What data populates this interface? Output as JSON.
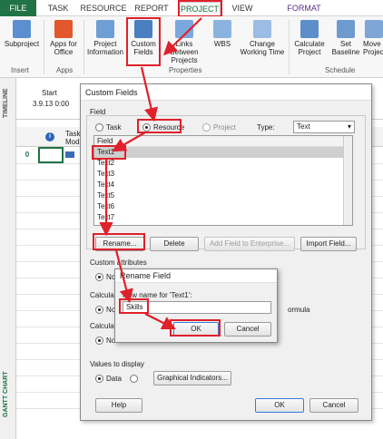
{
  "tabs": {
    "file": "FILE",
    "task": "TASK",
    "resource": "RESOURCE",
    "report": "REPORT",
    "project": "PROJECT",
    "view": "VIEW",
    "format": "FORMAT"
  },
  "ribbon": {
    "subproject": "Subproject",
    "apps_for_office": "Apps for Office",
    "project_information": "Project Information",
    "custom_fields": "Custom Fields",
    "links_between_projects": "Links Between Projects",
    "wbs": "WBS",
    "change_working_time": "Change Working Time",
    "calculate_project": "Calculate Project",
    "set_baseline": "Set Baseline",
    "move_project": "Move Project",
    "group_insert": "Insert",
    "group_apps": "Apps",
    "group_properties": "Properties",
    "group_schedule": "Schedule"
  },
  "timeline": {
    "label": "TIMELINE",
    "start_label": "Start",
    "start_value": "3.9.13 0:00"
  },
  "grid": {
    "row_number": "0",
    "task_mode_header": "Task Mode",
    "side_label": "GANTT CHART"
  },
  "custom_fields_dialog": {
    "title": "Custom Fields",
    "field_section": "Field",
    "task_option": "Task",
    "resource_option": "Resource",
    "project_option": "Project",
    "type_label": "Type:",
    "type_value": "Text",
    "list_header": "Field",
    "fields": [
      "Text1",
      "Text2",
      "Text3",
      "Text4",
      "Text5",
      "Text6",
      "Text7"
    ],
    "rename_button": "Rename...",
    "delete_button": "Delete",
    "add_field_button": "Add Field to Enterprise...",
    "import_field_button": "Import Field...",
    "custom_attributes": "Custom attributes",
    "calculation_1": "Calcula",
    "calculation_2": "Calcula",
    "partial_none": "No",
    "formula_suffix": "ormula",
    "values_to_display": "Values to display",
    "data_option": "Data",
    "graphical_indicators_button": "Graphical Indicators...",
    "help_button": "Help",
    "ok_button": "OK",
    "cancel_button": "Cancel"
  },
  "rename_dialog": {
    "title": "Rename Field",
    "prompt": "New name for 'Text1':",
    "value": "Skills",
    "ok_button": "OK",
    "cancel_button": "Cancel"
  }
}
